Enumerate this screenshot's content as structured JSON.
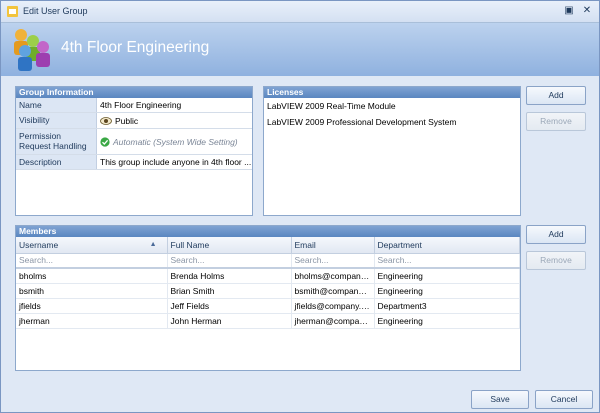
{
  "window": {
    "title": "Edit User Group"
  },
  "banner": {
    "group_name": "4th Floor Engineering"
  },
  "group_info": {
    "header": "Group Information",
    "rows": [
      {
        "name": "Name",
        "value": "4th Floor Engineering"
      },
      {
        "name": "Visibility",
        "value": "Public"
      },
      {
        "name": "Permission Request Handling",
        "value": "Automatic (System Wide Setting)"
      },
      {
        "name": "Description",
        "value": "This group include anyone in 4th floor ..."
      }
    ]
  },
  "licenses": {
    "header": "Licenses",
    "items": [
      "LabVIEW 2009 Real-Time Module",
      "LabVIEW 2009 Professional Development System"
    ],
    "add_label": "Add",
    "remove_label": "Remove"
  },
  "members": {
    "header": "Members",
    "columns": [
      "Username",
      "Full Name",
      "Email",
      "Department"
    ],
    "filter_placeholder": "Search...",
    "rows": [
      [
        "bholms",
        "Brenda Holms",
        "bholms@company.c...",
        "Engineering"
      ],
      [
        "bsmith",
        "Brian Smith",
        "bsmith@company.c...",
        "Engineering"
      ],
      [
        "jfields",
        "Jeff Fields",
        "jfields@company.com",
        "Department3"
      ],
      [
        "jherman",
        "John Herman",
        "jherman@company....",
        "Engineering"
      ]
    ],
    "add_label": "Add",
    "remove_label": "Remove"
  },
  "footer": {
    "save_label": "Save",
    "cancel_label": "Cancel"
  }
}
